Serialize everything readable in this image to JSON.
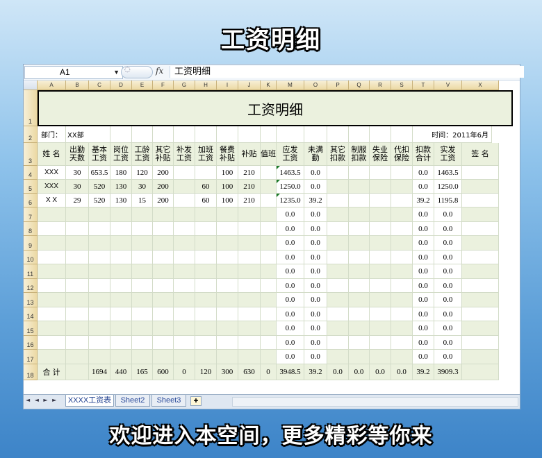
{
  "banner_top": "工资明细",
  "banner_bottom": "欢迎进入本空间，更多精彩等你来",
  "formula_bar": {
    "name_box": "A1",
    "fx_label": "fx",
    "formula": "工资明细"
  },
  "columns": [
    "A",
    "B",
    "C",
    "D",
    "E",
    "F",
    "G",
    "H",
    "I",
    "J",
    "K",
    "M",
    "O",
    "P",
    "Q",
    "R",
    "S",
    "T",
    "V",
    "X"
  ],
  "row_numbers": [
    "1",
    "2",
    "3",
    "4",
    "5",
    "6",
    "7",
    "8",
    "9",
    "10",
    "11",
    "12",
    "13",
    "14",
    "15",
    "16",
    "17",
    "18"
  ],
  "sheet": {
    "title": "工资明细",
    "dept": "部门：",
    "dept_value": "XX部",
    "time": "时间：2011年6月",
    "headers": [
      "姓 名",
      "出勤\n天数",
      "基本\n工资",
      "岗位\n工资",
      "工龄\n工资",
      "其它\n补贴",
      "补发\n工资",
      "加班\n工资",
      "餐费\n补贴",
      "补贴",
      "值班",
      "应发\n工资",
      "未满\n勤",
      "其它\n扣款",
      "制服\n扣款",
      "失业\n保险",
      "代扣\n保险",
      "扣款\n合计",
      "实发\n工资",
      "签 名"
    ],
    "rows": [
      [
        "XXX",
        "30",
        "653.5",
        "180",
        "120",
        "200",
        "",
        "",
        "100",
        "210",
        "",
        "1463.5",
        "0.0",
        "",
        "",
        "",
        "",
        "0.0",
        "1463.5",
        ""
      ],
      [
        "XXX",
        "30",
        "520",
        "130",
        "30",
        "200",
        "",
        "60",
        "100",
        "210",
        "",
        "1250.0",
        "0.0",
        "",
        "",
        "",
        "",
        "0.0",
        "1250.0",
        ""
      ],
      [
        "X X",
        "29",
        "520",
        "130",
        "15",
        "200",
        "",
        "60",
        "100",
        "210",
        "",
        "1235.0",
        "39.2",
        "",
        "",
        "",
        "",
        "39.2",
        "1195.8",
        ""
      ],
      [
        "",
        "",
        "",
        "",
        "",
        "",
        "",
        "",
        "",
        "",
        "",
        "0.0",
        "0.0",
        "",
        "",
        "",
        "",
        "0.0",
        "0.0",
        ""
      ],
      [
        "",
        "",
        "",
        "",
        "",
        "",
        "",
        "",
        "",
        "",
        "",
        "0.0",
        "0.0",
        "",
        "",
        "",
        "",
        "0.0",
        "0.0",
        ""
      ],
      [
        "",
        "",
        "",
        "",
        "",
        "",
        "",
        "",
        "",
        "",
        "",
        "0.0",
        "0.0",
        "",
        "",
        "",
        "",
        "0.0",
        "0.0",
        ""
      ],
      [
        "",
        "",
        "",
        "",
        "",
        "",
        "",
        "",
        "",
        "",
        "",
        "0.0",
        "0.0",
        "",
        "",
        "",
        "",
        "0.0",
        "0.0",
        ""
      ],
      [
        "",
        "",
        "",
        "",
        "",
        "",
        "",
        "",
        "",
        "",
        "",
        "0.0",
        "0.0",
        "",
        "",
        "",
        "",
        "0.0",
        "0.0",
        ""
      ],
      [
        "",
        "",
        "",
        "",
        "",
        "",
        "",
        "",
        "",
        "",
        "",
        "0.0",
        "0.0",
        "",
        "",
        "",
        "",
        "0.0",
        "0.0",
        ""
      ],
      [
        "",
        "",
        "",
        "",
        "",
        "",
        "",
        "",
        "",
        "",
        "",
        "0.0",
        "0.0",
        "",
        "",
        "",
        "",
        "0.0",
        "0.0",
        ""
      ],
      [
        "",
        "",
        "",
        "",
        "",
        "",
        "",
        "",
        "",
        "",
        "",
        "0.0",
        "0.0",
        "",
        "",
        "",
        "",
        "0.0",
        "0.0",
        ""
      ],
      [
        "",
        "",
        "",
        "",
        "",
        "",
        "",
        "",
        "",
        "",
        "",
        "0.0",
        "0.0",
        "",
        "",
        "",
        "",
        "0.0",
        "0.0",
        ""
      ],
      [
        "",
        "",
        "",
        "",
        "",
        "",
        "",
        "",
        "",
        "",
        "",
        "0.0",
        "0.0",
        "",
        "",
        "",
        "",
        "0.0",
        "0.0",
        ""
      ],
      [
        "",
        "",
        "",
        "",
        "",
        "",
        "",
        "",
        "",
        "",
        "",
        "0.0",
        "0.0",
        "",
        "",
        "",
        "",
        "0.0",
        "0.0",
        ""
      ]
    ],
    "total": [
      "合 计",
      "",
      "1694",
      "440",
      "165",
      "600",
      "0",
      "120",
      "300",
      "630",
      "0",
      "3948.5",
      "39.2",
      "0.0",
      "0.0",
      "0.0",
      "0.0",
      "39.2",
      "3909.3",
      ""
    ]
  },
  "tabs": {
    "nav": "◄ ◄ ► ►",
    "items": [
      "XXXX工资表",
      "Sheet2",
      "Sheet3"
    ],
    "active_index": 0
  }
}
